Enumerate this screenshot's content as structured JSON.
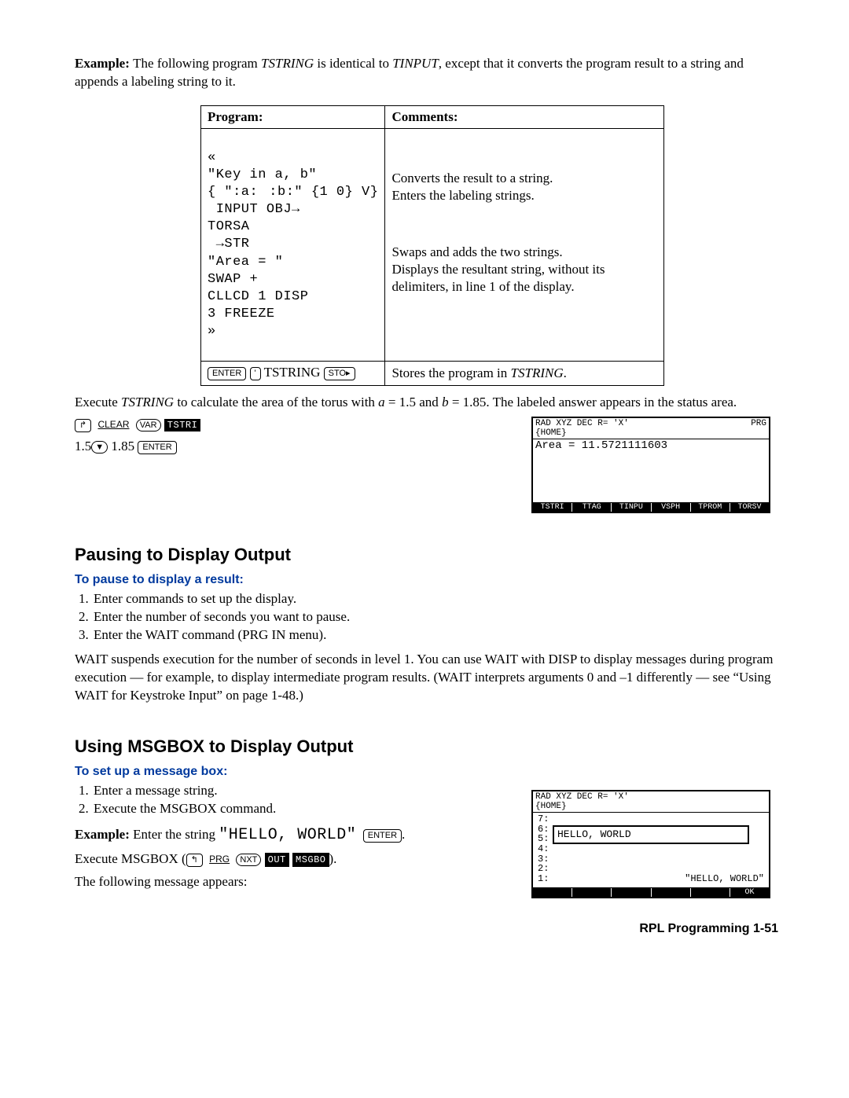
{
  "intro": {
    "example_label": "Example: ",
    "text1": "The following program ",
    "prog1": "TSTRING",
    "text2": " is identical to ",
    "prog2": "TINPUT",
    "text3": ", except that it converts the program result to a string and appends a labeling string to it."
  },
  "table": {
    "head_program": "Program:",
    "head_comments": "Comments:",
    "rows": [
      {
        "code": "«",
        "comment": ""
      },
      {
        "code": "\"Key in a, b\"",
        "comment": ""
      },
      {
        "code": "{ \":a::b:\" {1 0} V}\n INPUT OBJ→\nTORSA\n →STR\n\"Area = \"",
        "comment": "Converts the result to a string.\nEnters the labeling strings."
      },
      {
        "code": "SWAP +",
        "comment": "Swaps and adds the two strings."
      },
      {
        "code": "CLLCD 1 DISP\n3 FREEZE",
        "comment": "Displays the resultant string, without its delimiters, in line 1 of the display."
      },
      {
        "code": "»",
        "comment": ""
      }
    ],
    "store_row": {
      "enter_key": "ENTER",
      "tick_key": "'",
      "name": " TSTRING ",
      "sto_key": "STO▸",
      "comment_a": "Stores the program in ",
      "comment_b": "TSTRING",
      "comment_c": "."
    }
  },
  "exec": {
    "para_a": "Execute ",
    "prog": "TSTRING",
    "para_b": " to calculate the area of the torus with ",
    "a_lbl": "a",
    "a_val": " = 1.5 and ",
    "b_lbl": "b",
    "b_val": " = 1.85. The labeled answer appears in the status area.",
    "keys1": {
      "shift": "↱",
      "clear": "CLEAR",
      "var": "VAR",
      "menu": "TSTRI"
    },
    "keys2": {
      "a": "1.5",
      "down": "▼",
      "b": " 1.85 ",
      "enter": "ENTER"
    }
  },
  "lcd1": {
    "hdr_left": "RAD XYZ DEC R= 'X'",
    "hdr_right": "PRG",
    "home": "{HOME}",
    "body": "Area = 11.5721111603",
    "menu": [
      "TSTRI",
      "TTAG",
      "TINPU",
      "VSPH",
      "TPROM",
      "TORSV"
    ]
  },
  "pausing": {
    "h": "Pausing to Display Output",
    "sub": "To pause to display a result:",
    "steps": [
      "Enter commands to set up the display.",
      "Enter the number of seconds you want to pause.",
      "Enter the WAIT command (PRG IN menu)."
    ],
    "para": "WAIT suspends execution for the number of seconds in level 1. You can use WAIT with DISP to display messages during program execution — for example, to display intermediate program results. (WAIT interprets arguments 0 and –1 differently — see “Using WAIT for Keystroke Input” on page 1-48.)"
  },
  "msgbox": {
    "h": "Using MSGBOX to Display Output",
    "sub": "To set up a message box:",
    "steps": [
      "Enter a message string.",
      "Execute the MSGBOX command."
    ],
    "ex_label": "Example: ",
    "ex_a": "Enter the string ",
    "ex_str": "\"HELLO, WORLD\"",
    "ex_enter": "ENTER",
    "ex_period": ".",
    "exec_a": "Execute MSGBOX (",
    "exec_keys": {
      "ls": "↰",
      "prg": "PRG",
      "nxt": "NXT",
      "out": "OUT",
      "msgbo": "MSGBO"
    },
    "exec_b": ").",
    "follow": "The following message appears:"
  },
  "lcd2": {
    "hdr_left": "RAD XYZ DEC R= 'X'",
    "hdr_right": "",
    "home": "{HOME}",
    "stack": [
      "7:",
      "6:",
      "5:",
      "4:",
      "3:",
      "2:",
      "1:"
    ],
    "box_text": "HELLO, WORLD",
    "stack_line": "\"HELLO, WORLD\"",
    "ok": "OK"
  },
  "footer": {
    "label": "RPL Programming  ",
    "page": "1-51"
  }
}
